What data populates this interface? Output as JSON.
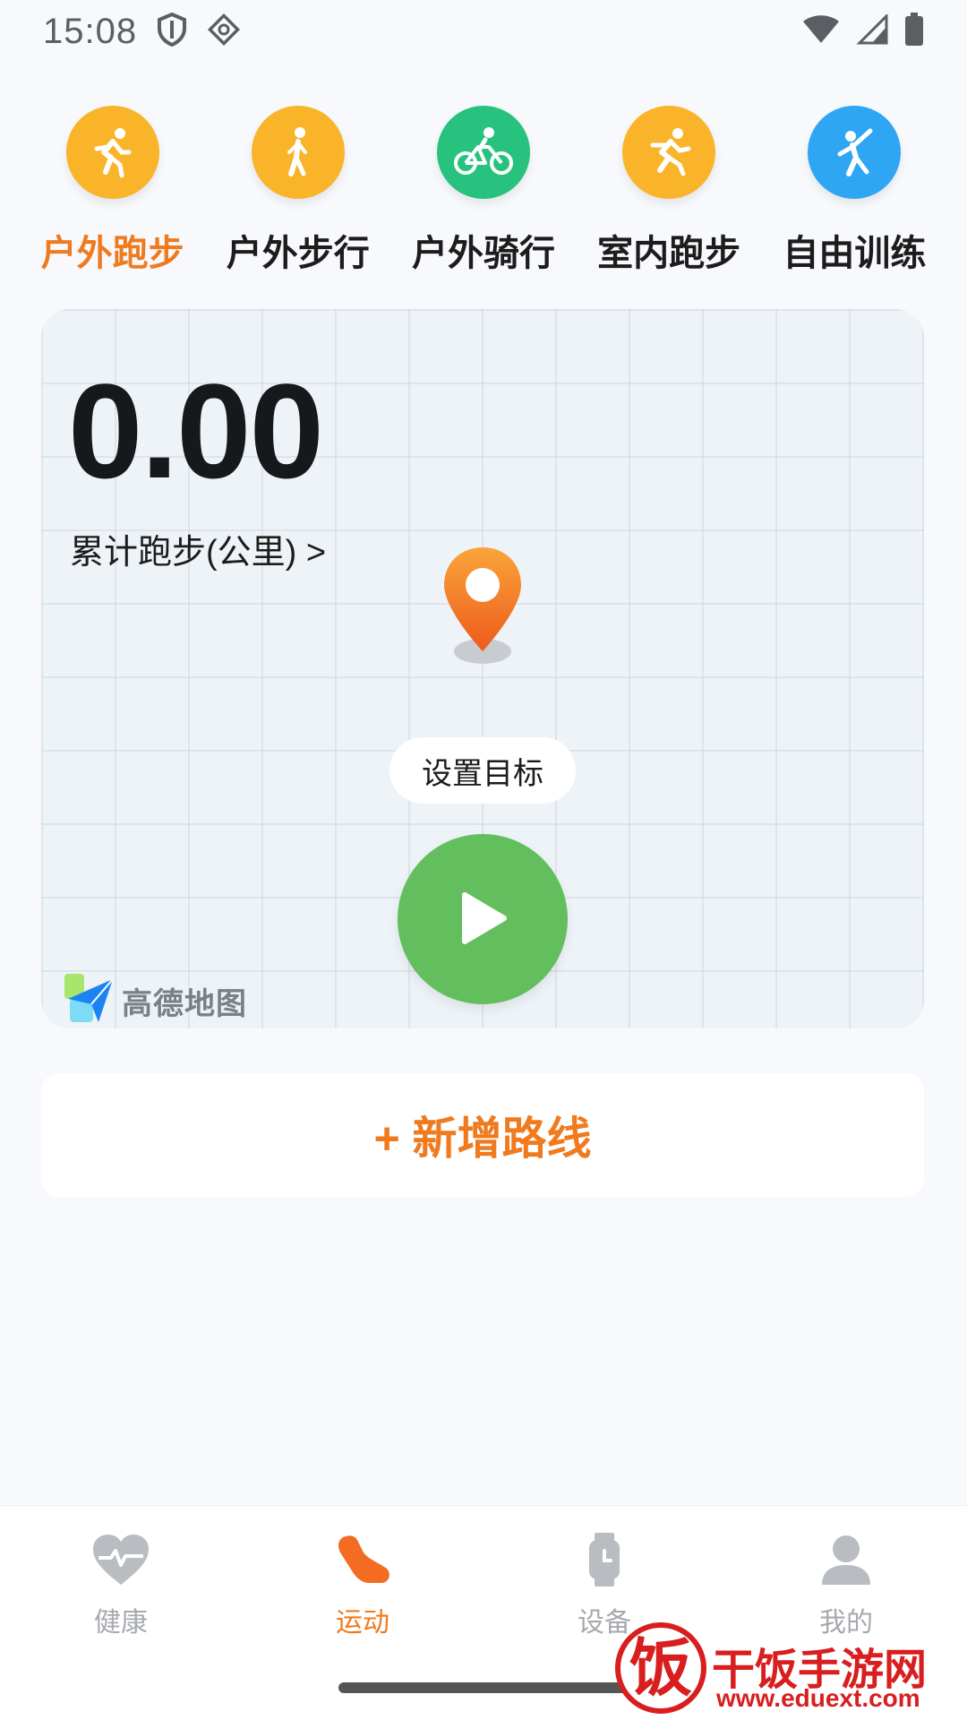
{
  "status_bar": {
    "time": "15:08",
    "icons": [
      "shield-icon",
      "vpn-icon",
      "wifi-icon",
      "signal-icon",
      "battery-icon"
    ]
  },
  "activities": [
    {
      "label": "户外跑步",
      "icon": "running-icon",
      "color": "#f9b42a",
      "active": true
    },
    {
      "label": "户外步行",
      "icon": "walking-icon",
      "color": "#f9b42a",
      "active": false
    },
    {
      "label": "户外骑行",
      "icon": "cycling-icon",
      "color": "#27c27d",
      "active": false
    },
    {
      "label": "室内跑步",
      "icon": "indoor-running-icon",
      "color": "#f9b42a",
      "active": false
    },
    {
      "label": "自由训练",
      "icon": "free-training-icon",
      "color": "#2fa6f4",
      "active": false
    }
  ],
  "map_card": {
    "distance": "0.00",
    "distance_label": "累计跑步(公里) >",
    "goal_button": "设置目标",
    "map_logo_text": "高德地图"
  },
  "add_route": {
    "label": "+ 新增路线"
  },
  "bottom_nav": [
    {
      "label": "健康",
      "icon": "heart-icon",
      "active": false
    },
    {
      "label": "运动",
      "icon": "shoe-icon",
      "active": true
    },
    {
      "label": "设备",
      "icon": "watch-icon",
      "active": false
    },
    {
      "label": "我的",
      "icon": "person-icon",
      "active": false
    }
  ],
  "watermark": {
    "logo_char": "饭",
    "title": "干饭手游网",
    "url": "www.eduext.com"
  },
  "colors": {
    "accent": "#f07a1e",
    "start_green": "#63bf5e",
    "inactive_gray": "#a6a9ae"
  }
}
